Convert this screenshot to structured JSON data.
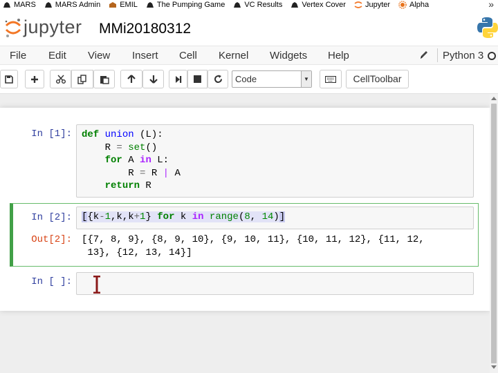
{
  "bookmarks": [
    {
      "label": "MARS",
      "icon": "bookmark-icon"
    },
    {
      "label": "MARS Admin",
      "icon": "bookmark-icon"
    },
    {
      "label": "EMIL",
      "icon": "bookmark-icon"
    },
    {
      "label": "The Pumping Game",
      "icon": "bookmark-icon"
    },
    {
      "label": "VC Results",
      "icon": "bookmark-icon"
    },
    {
      "label": "Vertex Cover",
      "icon": "bookmark-icon"
    },
    {
      "label": "Jupyter",
      "icon": "jupyter-icon"
    },
    {
      "label": "Alpha",
      "icon": "sun-icon"
    }
  ],
  "bookmarks_more": "»",
  "header": {
    "logo_text": "jupyter",
    "notebook_title": "MMi20180312"
  },
  "menu": {
    "items": [
      "File",
      "Edit",
      "View",
      "Insert",
      "Cell",
      "Kernel",
      "Widgets",
      "Help"
    ],
    "kernel_name": "Python 3"
  },
  "toolbar": {
    "buttons": [
      "save-icon",
      "plus-icon",
      "cut-icon",
      "copy-icon",
      "paste-icon",
      "arrow-up-icon",
      "arrow-down-icon",
      "step-forward-icon",
      "stop-icon",
      "restart-icon",
      "keyboard-icon"
    ],
    "cell_type": "Code",
    "celltoolbar_label": "CellToolbar"
  },
  "cells": [
    {
      "prompt": "In [1]:",
      "code_lines": [
        "def union (L):",
        "    R = set()",
        "    for A in L:",
        "        R = R | A",
        "    return R"
      ]
    },
    {
      "prompt": "In [2]:",
      "code": "[{k-1,k,k+1} for k in range(8, 14)]",
      "out_prompt": "Out[2]:",
      "output_lines": [
        "[{7, 8, 9}, {8, 9, 10}, {9, 10, 11}, {10, 11, 12}, {11, 12,",
        " 13}, {12, 13, 14}]"
      ]
    },
    {
      "prompt": "In [ ]:",
      "code": ""
    }
  ],
  "colors": {
    "in_prompt": "#303f9f",
    "out_prompt": "#d84315",
    "selected_border": "#42a047",
    "keyword": "#008000"
  }
}
